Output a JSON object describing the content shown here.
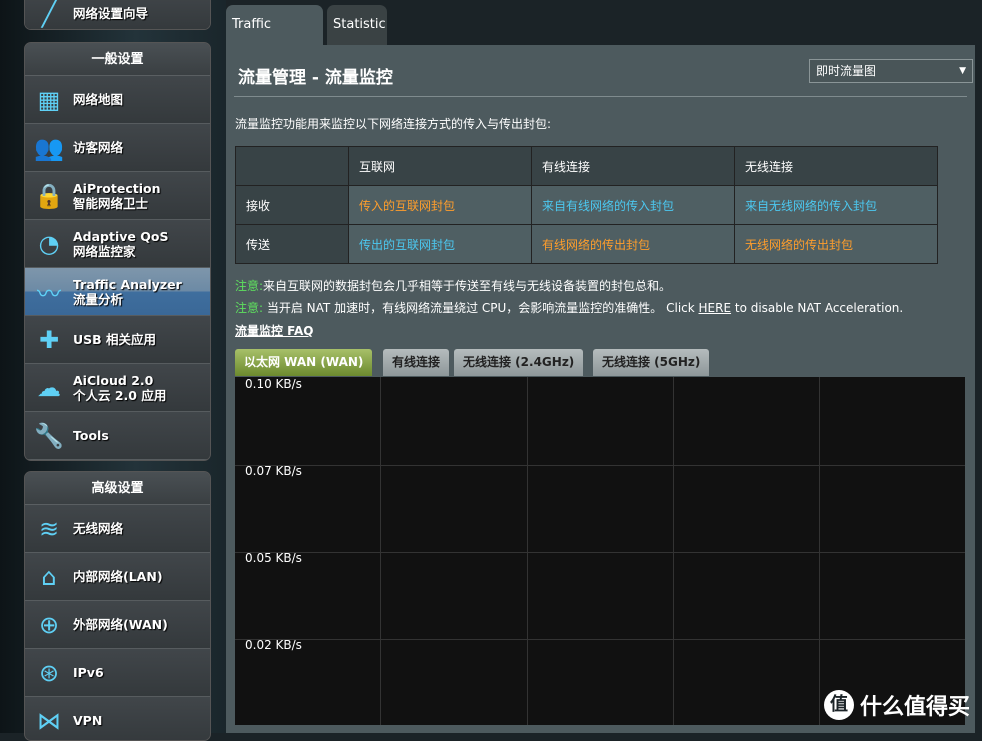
{
  "sidebar": {
    "top_item": "网络设置向导",
    "general": {
      "header": "一般设置",
      "items": [
        {
          "icon": "network-map-icon",
          "l1": "网络地图",
          "l2": ""
        },
        {
          "icon": "guest-network-icon",
          "l1": "访客网络",
          "l2": ""
        },
        {
          "icon": "lock-icon",
          "l1": "AiProtection",
          "l2": "智能网络卫士"
        },
        {
          "icon": "speedometer-icon",
          "l1": "Adaptive QoS",
          "l2": "网络监控家"
        },
        {
          "icon": "traffic-graph-icon",
          "l1": "Traffic Analyzer",
          "l2": "流量分析",
          "active": true
        },
        {
          "icon": "puzzle-icon",
          "l1": "USB 相关应用",
          "l2": ""
        },
        {
          "icon": "cloud-icon",
          "l1": "AiCloud 2.0",
          "l2": "个人云 2.0 应用"
        },
        {
          "icon": "wrench-icon",
          "l1": "Tools",
          "l2": ""
        }
      ]
    },
    "advanced": {
      "header": "高级设置",
      "items": [
        {
          "icon": "wifi-icon",
          "l1": "无线网络"
        },
        {
          "icon": "home-icon",
          "l1": "内部网络(LAN)"
        },
        {
          "icon": "globe-icon",
          "l1": "外部网络(WAN)"
        },
        {
          "icon": "ipv6-icon",
          "l1": "IPv6"
        },
        {
          "icon": "vpn-icon",
          "l1": "VPN"
        }
      ]
    }
  },
  "tabs": [
    "Traffic Monitor",
    "Statistic"
  ],
  "main": {
    "title": "流量管理 - 流量监控",
    "select": "即时流量图",
    "desc": "流量监控功能用来监控以下网络连接方式的传入与传出封包:",
    "table": {
      "headers": [
        "",
        "互联网",
        "有线连接",
        "无线连接"
      ],
      "rows": [
        [
          "接收",
          "传入的互联网封包",
          "来自有线网络的传入封包",
          "来自无线网络的传入封包"
        ],
        [
          "传送",
          "传出的互联网封包",
          "有线网络的传出封包",
          "无线网络的传出封包"
        ]
      ]
    },
    "note_label": "注意:",
    "note1": "来自互联网的数据封包会几乎相等于传送至有线与无线设备装置的封包总和。",
    "note2": " 当开启 NAT 加速时，有线网络流量绕过 CPU，会影响流量监控的准确性。 Click ",
    "here": "HERE",
    "note2b": " to disable NAT Acceleration.",
    "faq": "流量监控 FAQ",
    "graph_tabs": [
      "以太网 WAN (WAN)",
      "有线连接",
      "无线连接 (2.4GHz)",
      "无线连接 (5GHz)"
    ],
    "y_labels": [
      "0.10 KB/s",
      "0.07 KB/s",
      "0.05 KB/s",
      "0.02 KB/s"
    ]
  },
  "watermark": "什么值得买",
  "colors": {
    "incoming": "#ff9e2c",
    "outgoing": "#4cc8f0",
    "active": "#3f6e9e",
    "note": "#5ee05e"
  }
}
